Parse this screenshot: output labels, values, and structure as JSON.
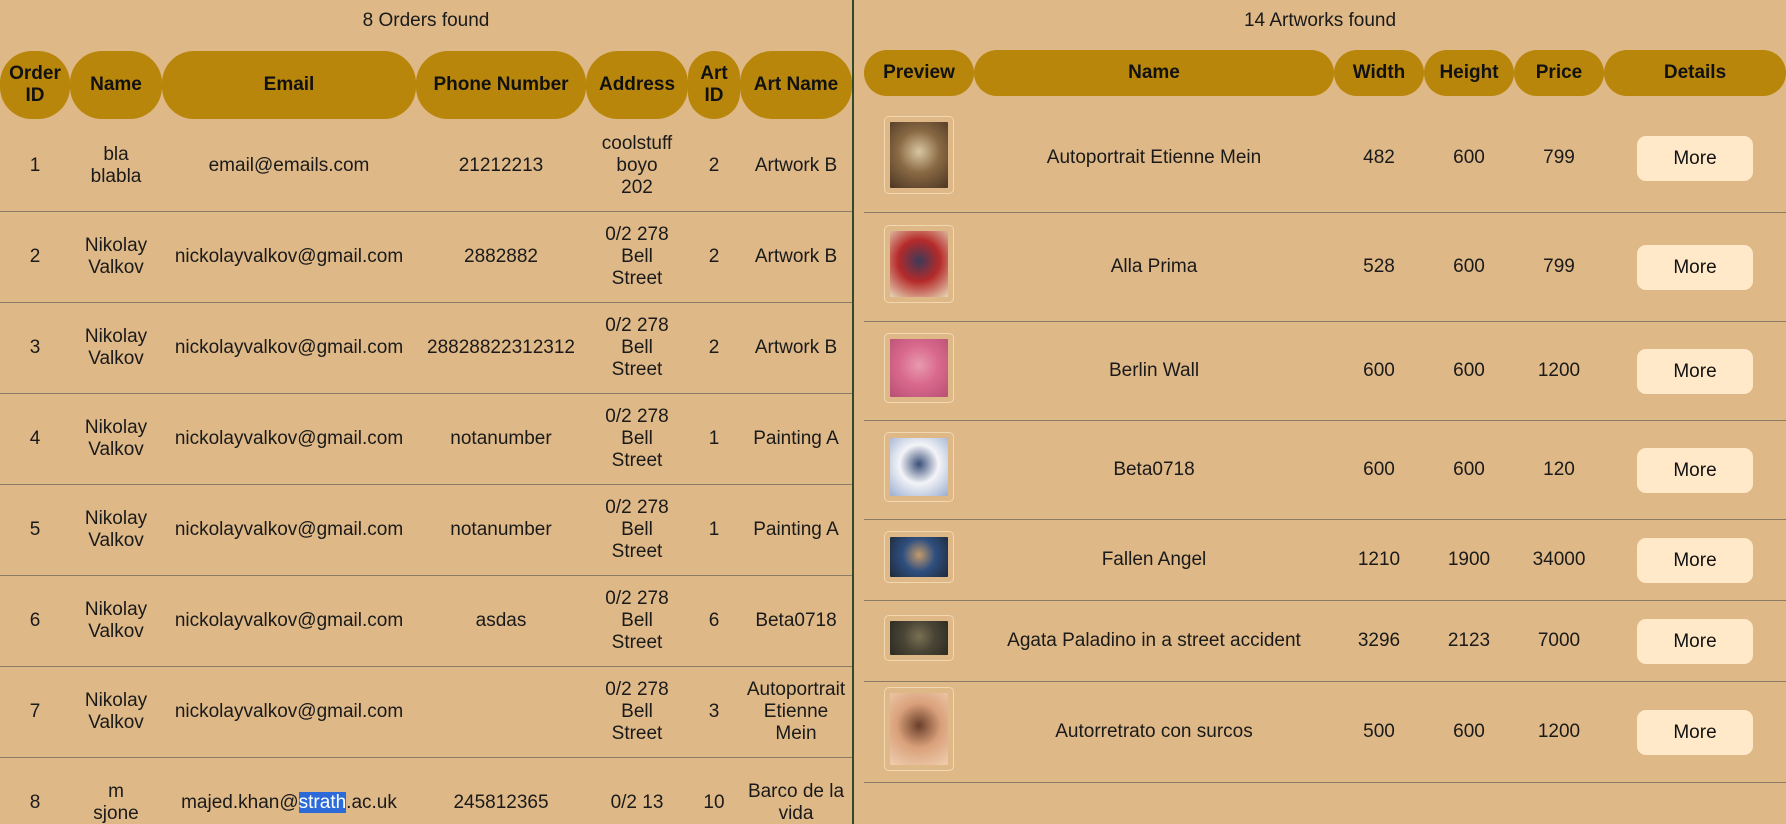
{
  "orders": {
    "title": "8 Orders found",
    "headers": {
      "order_id_line1": "Order",
      "order_id_line2": "ID",
      "name": "Name",
      "email": "Email",
      "phone": "Phone Number",
      "address": "Address",
      "art_id_line1": "Art",
      "art_id_line2": "ID",
      "art_name": "Art Name"
    },
    "rows": [
      {
        "id": "1",
        "name": [
          "bla",
          "blabla"
        ],
        "email": "email@emails.com",
        "phone": "21212213",
        "address": [
          "coolstuff",
          "boyo",
          "202"
        ],
        "art_id": "2",
        "art_name": [
          "Artwork B"
        ]
      },
      {
        "id": "2",
        "name": [
          "Nikolay",
          "Valkov"
        ],
        "email": "nickolayvalkov@gmail.com",
        "phone": "2882882",
        "address": [
          "0/2 278",
          "Bell",
          "Street"
        ],
        "art_id": "2",
        "art_name": [
          "Artwork B"
        ]
      },
      {
        "id": "3",
        "name": [
          "Nikolay",
          "Valkov"
        ],
        "email": "nickolayvalkov@gmail.com",
        "phone": "28828822312312",
        "address": [
          "0/2 278",
          "Bell",
          "Street"
        ],
        "art_id": "2",
        "art_name": [
          "Artwork B"
        ]
      },
      {
        "id": "4",
        "name": [
          "Nikolay",
          "Valkov"
        ],
        "email": "nickolayvalkov@gmail.com",
        "phone": "notanumber",
        "address": [
          "0/2 278",
          "Bell",
          "Street"
        ],
        "art_id": "1",
        "art_name": [
          "Painting A"
        ]
      },
      {
        "id": "5",
        "name": [
          "Nikolay",
          "Valkov"
        ],
        "email": "nickolayvalkov@gmail.com",
        "phone": "notanumber",
        "address": [
          "0/2 278",
          "Bell",
          "Street"
        ],
        "art_id": "1",
        "art_name": [
          "Painting A"
        ]
      },
      {
        "id": "6",
        "name": [
          "Nikolay",
          "Valkov"
        ],
        "email": "nickolayvalkov@gmail.com",
        "phone": "asdas",
        "address": [
          "0/2 278",
          "Bell",
          "Street"
        ],
        "art_id": "6",
        "art_name": [
          "Beta0718"
        ]
      },
      {
        "id": "7",
        "name": [
          "Nikolay",
          "Valkov"
        ],
        "email": "nickolayvalkov@gmail.com",
        "phone": "",
        "address": [
          "0/2 278",
          "Bell",
          "Street"
        ],
        "art_id": "3",
        "art_name": [
          "Autoportrait",
          "Etienne",
          "Mein"
        ]
      },
      {
        "id": "8",
        "name": [
          "m",
          "sjone"
        ],
        "email_parts": [
          "majed.khan@",
          "strath",
          ".ac.uk"
        ],
        "phone": "245812365",
        "address": [
          "0/2 13"
        ],
        "art_id": "10",
        "art_name": [
          "Barco de la",
          "vida"
        ]
      }
    ]
  },
  "artworks": {
    "title": "14 Artworks found",
    "headers": {
      "preview": "Preview",
      "name": "Name",
      "width": "Width",
      "height": "Height",
      "price": "Price",
      "details": "Details"
    },
    "more_label": "More",
    "rows": [
      {
        "name": "Autoportrait Etienne Mein",
        "width": "482",
        "height": "600",
        "price": "799",
        "thumb_colors": [
          "#8a6a45",
          "#d8c7a2",
          "#4b3522"
        ]
      },
      {
        "name": "Alla Prima",
        "width": "528",
        "height": "600",
        "price": "799",
        "thumb_colors": [
          "#b52a2a",
          "#3d3a58",
          "#e6d8b8"
        ]
      },
      {
        "name": "Berlin Wall",
        "width": "600",
        "height": "600",
        "price": "1200",
        "thumb_colors": [
          "#d96a8e",
          "#e89ab0",
          "#b84f74"
        ]
      },
      {
        "name": "Beta0718",
        "width": "600",
        "height": "600",
        "price": "120",
        "thumb_colors": [
          "#f4f4f8",
          "#3b4f7a",
          "#9aaed0"
        ]
      },
      {
        "name": "Fallen Angel",
        "width": "1210",
        "height": "1900",
        "price": "34000",
        "thumb_colors": [
          "#2f4f7f",
          "#c39a6b",
          "#1e2a3a"
        ]
      },
      {
        "name": "Agata Paladino in a street accident",
        "width": "3296",
        "height": "2123",
        "price": "7000",
        "thumb_colors": [
          "#4a4636",
          "#7a6f52",
          "#2c2a22"
        ]
      },
      {
        "name": "Autorretrato con surcos",
        "width": "500",
        "height": "600",
        "price": "1200",
        "thumb_colors": [
          "#d9a07a",
          "#6a3e2a",
          "#f0cfb0"
        ]
      }
    ]
  }
}
